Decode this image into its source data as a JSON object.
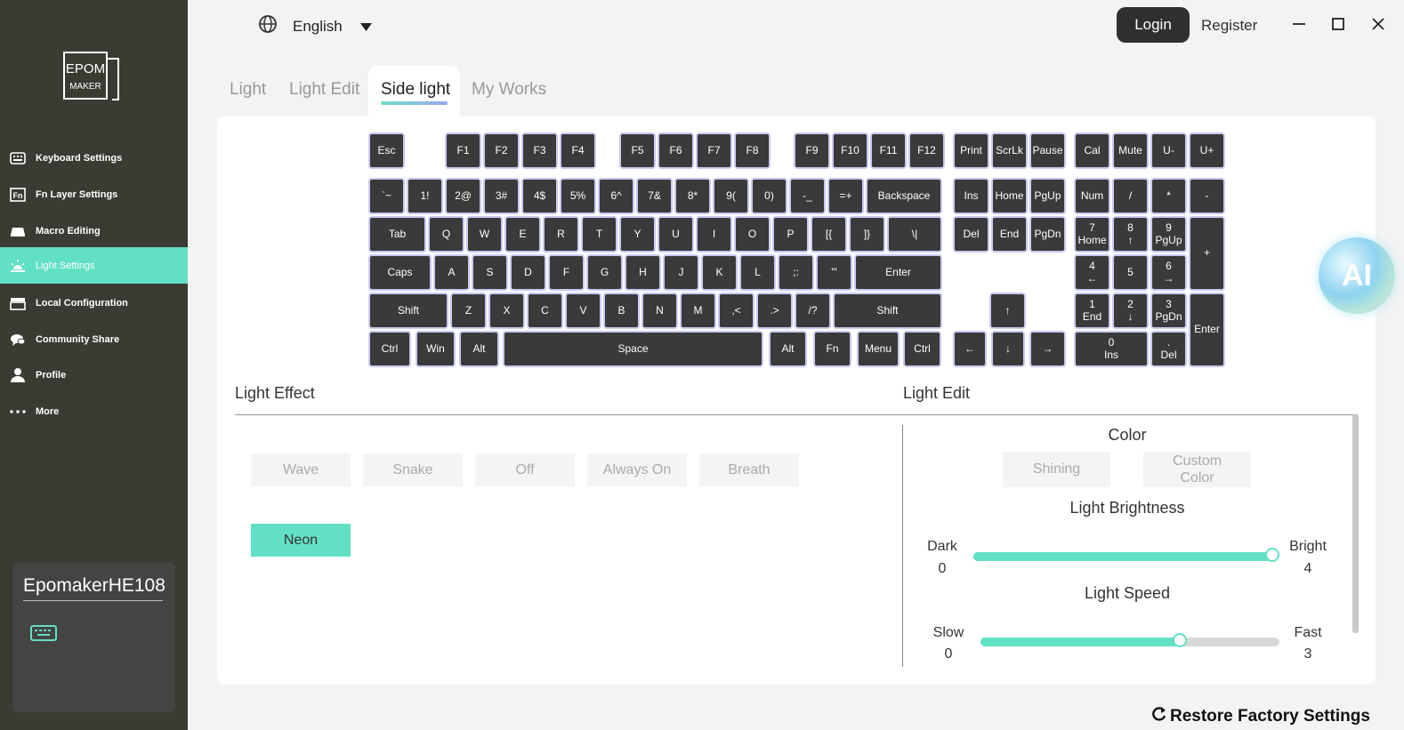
{
  "sidebar": {
    "logo_text_top": "EPOM",
    "logo_text_bottom": "MAKER",
    "items": [
      {
        "label": "Keyboard Settings",
        "icon": "keyboard-icon"
      },
      {
        "label": "Fn Layer Settings",
        "icon": "fn-icon"
      },
      {
        "label": "Macro Editing",
        "icon": "macro-icon"
      },
      {
        "label": "Light Settings",
        "icon": "light-icon",
        "active": true
      },
      {
        "label": "Local Configuration",
        "icon": "storage-icon"
      },
      {
        "label": "Community Share",
        "icon": "chat-icon"
      },
      {
        "label": "Profile",
        "icon": "user-icon"
      },
      {
        "label": "More",
        "icon": "more-icon"
      }
    ],
    "device": {
      "name": "EpomakerHE108",
      "icon": "keyboard-icon"
    }
  },
  "topbar": {
    "language": "English",
    "login": "Login",
    "register": "Register"
  },
  "tabs": [
    "Light",
    "Light Edit",
    "Side light",
    "My Works"
  ],
  "active_tab": "Side light",
  "keyboard": {
    "rows": [
      [
        "Esc",
        "F1",
        "F2",
        "F3",
        "F4",
        "F5",
        "F6",
        "F7",
        "F8",
        "F9",
        "F10",
        "F11",
        "F12",
        "Print",
        "ScrLk",
        "Pause",
        "Cal",
        "Mute",
        "U-",
        "U+"
      ],
      [
        "`~",
        "1!",
        "2@",
        "3#",
        "4$",
        "5%",
        "6^",
        "7&",
        "8*",
        "9(",
        "0)",
        "-_",
        "=+",
        "Backspace",
        "Ins",
        "Home",
        "PgUp",
        "Num",
        "/",
        "*",
        "-"
      ],
      [
        "Tab",
        "Q",
        "W",
        "E",
        "R",
        "T",
        "Y",
        "U",
        "I",
        "O",
        "P",
        "[{",
        "]}",
        "\\|",
        "Del",
        "End",
        "PgDn",
        "7\nHome",
        "8\n↑",
        "9\nPgUp",
        "+"
      ],
      [
        "Caps",
        "A",
        "S",
        "D",
        "F",
        "G",
        "H",
        "J",
        "K",
        "L",
        ";:",
        "'\"",
        "Enter",
        "4\n←",
        "5",
        "6\n→"
      ],
      [
        "Shift",
        "Z",
        "X",
        "C",
        "V",
        "B",
        "N",
        "M",
        ",<",
        ".>",
        "/?",
        "Shift",
        "↑",
        "1\nEnd",
        "2\n↓",
        "3\nPgDn",
        "Enter"
      ],
      [
        "Ctrl",
        "Win",
        "Alt",
        "Space",
        "Alt",
        "Fn",
        "Menu",
        "Ctrl",
        "←",
        "↓",
        "→",
        "0\nIns",
        ".\nDel"
      ]
    ]
  },
  "light_effect": {
    "title": "Light Effect",
    "effects": [
      "Wave",
      "Snake",
      "Off",
      "Always On",
      "Breath",
      "Neon"
    ],
    "selected": "Neon"
  },
  "light_edit": {
    "title": "Light Edit",
    "color_label": "Color",
    "color_options": [
      "Shining",
      "Custom Color"
    ],
    "brightness": {
      "label": "Light Brightness",
      "min_label": "Dark",
      "min": "0",
      "max_label": "Bright",
      "max": "4",
      "value": 4
    },
    "speed": {
      "label": "Light Speed",
      "min_label": "Slow",
      "min": "0",
      "max_label": "Fast",
      "max": "3",
      "value": 2
    }
  },
  "restore_label": "Restore Factory Settings",
  "ai_label": "AI",
  "colors": {
    "accent": "#62e0c4",
    "sidebar": "#3b3a33",
    "key": "#3a3a3a",
    "key_border": "#c8c9f2"
  }
}
